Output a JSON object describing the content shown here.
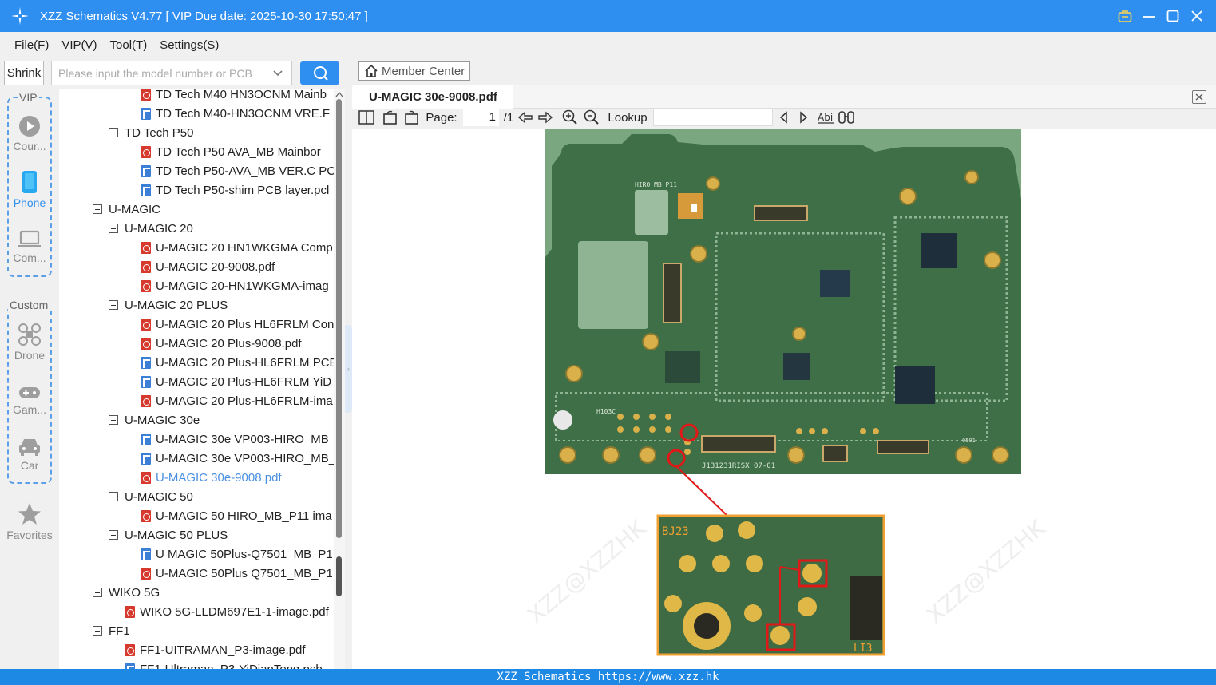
{
  "window": {
    "title": "XZZ Schematics V4.77 [ VIP Due date: 2025-10-30 17:50:47 ]"
  },
  "menu": [
    "File(F)",
    "VIP(V)",
    "Tool(T)",
    "Settings(S)"
  ],
  "toolbar": {
    "shrink_label": "Shrink",
    "search_placeholder": "Please input the model number or PCB"
  },
  "nav": {
    "vip_label": "VIP",
    "custom_label": "Custom",
    "items": [
      {
        "label": "Cour...",
        "icon": "play-circle-icon"
      },
      {
        "label": "Phone",
        "icon": "phone-icon"
      },
      {
        "label": "Com...",
        "icon": "laptop-icon"
      },
      {
        "label": "Drone",
        "icon": "drone-icon"
      },
      {
        "label": "Gam...",
        "icon": "gamepad-icon"
      },
      {
        "label": "Car",
        "icon": "car-icon"
      },
      {
        "label": "Favorites",
        "icon": "star-icon"
      }
    ]
  },
  "tree": [
    {
      "level": 3,
      "type": "pdf",
      "label": "TD Tech M40 HN3OCNM Mainb"
    },
    {
      "level": 3,
      "type": "pcb",
      "label": "TD Tech M40-HN3OCNM VRE.F"
    },
    {
      "level": 2,
      "type": "folder",
      "label": "TD Tech P50"
    },
    {
      "level": 3,
      "type": "pdf",
      "label": "TD Tech P50 AVA_MB Mainbor"
    },
    {
      "level": 3,
      "type": "pcb",
      "label": "TD Tech P50-AVA_MB VER.C PC"
    },
    {
      "level": 3,
      "type": "pcb",
      "label": "TD Tech P50-shim PCB layer.pcl"
    },
    {
      "level": 1,
      "type": "folder",
      "label": "U-MAGIC"
    },
    {
      "level": 2,
      "type": "folder",
      "label": "U-MAGIC 20"
    },
    {
      "level": 3,
      "type": "pdf",
      "label": "U-MAGIC 20 HN1WKGMA Comp"
    },
    {
      "level": 3,
      "type": "pdf",
      "label": "U-MAGIC 20-9008.pdf"
    },
    {
      "level": 3,
      "type": "pdf",
      "label": "U-MAGIC 20-HN1WKGMA-imag"
    },
    {
      "level": 2,
      "type": "folder",
      "label": "U-MAGIC 20 PLUS"
    },
    {
      "level": 3,
      "type": "pdf",
      "label": "U-MAGIC 20 Plus HL6FRLM Con"
    },
    {
      "level": 3,
      "type": "pdf",
      "label": "U-MAGIC 20 Plus-9008.pdf"
    },
    {
      "level": 3,
      "type": "pcb",
      "label": "U-MAGIC 20 Plus-HL6FRLM PCE"
    },
    {
      "level": 3,
      "type": "pcb",
      "label": "U-MAGIC 20 Plus-HL6FRLM YiD"
    },
    {
      "level": 3,
      "type": "pdf",
      "label": "U-MAGIC 20 Plus-HL6FRLM-ima"
    },
    {
      "level": 2,
      "type": "folder",
      "label": "U-MAGIC 30e"
    },
    {
      "level": 3,
      "type": "pcb",
      "label": "U-MAGIC 30e VP003-HIRO_MB_"
    },
    {
      "level": 3,
      "type": "pcb",
      "label": "U-MAGIC 30e VP003-HIRO_MB_"
    },
    {
      "level": 3,
      "type": "pdf",
      "label": "U-MAGIC 30e-9008.pdf",
      "selected": true
    },
    {
      "level": 2,
      "type": "folder",
      "label": "U-MAGIC 50"
    },
    {
      "level": 3,
      "type": "pdf",
      "label": "U-MAGIC 50 HIRO_MB_P11 ima"
    },
    {
      "level": 2,
      "type": "folder",
      "label": "U-MAGIC 50 PLUS"
    },
    {
      "level": 3,
      "type": "pcb",
      "label": "U MAGIC 50Plus-Q7501_MB_P1"
    },
    {
      "level": 3,
      "type": "pdf",
      "label": "U-MAGIC 50Plus Q7501_MB_P1"
    },
    {
      "level": 1,
      "type": "folder",
      "label": "WIKO 5G"
    },
    {
      "level": 2,
      "type": "pdf",
      "label": "WIKO 5G-LLDM697E1-1-image.pdf"
    },
    {
      "level": 1,
      "type": "folder",
      "label": "FF1"
    },
    {
      "level": 2,
      "type": "pdf",
      "label": "FF1-UITRAMAN_P3-image.pdf"
    },
    {
      "level": 2,
      "type": "pcb",
      "label": "FF1-Ultraman_P3-YiDianTong.pcb"
    }
  ],
  "right": {
    "member_center": "Member Center",
    "doc_tab": "U-MAGIC 30e-9008.pdf",
    "page_label": "Page:",
    "page_value": "1",
    "page_total": "/1",
    "lookup_label": "Lookup",
    "lookup_value": ""
  },
  "board": {
    "silk_top": "HIRO_MB_P11",
    "silk_bottom": "J131231RISX  07-01",
    "silk_side": "H103C",
    "silk_num": "0501",
    "zoom_silk": "BJ23",
    "zoom_corner": "LI3",
    "watermark": "XZZ@XZZHK"
  },
  "status": {
    "text": "XZZ Schematics https://www.xzz.hk"
  },
  "colors": {
    "titlebar": "#2f8ff0",
    "accent": "#2f8ff0",
    "pcb_green": "#3f6f46",
    "marker_red": "#e01818",
    "zoom_border": "#f0a030",
    "selected_text": "#4a90e2"
  }
}
